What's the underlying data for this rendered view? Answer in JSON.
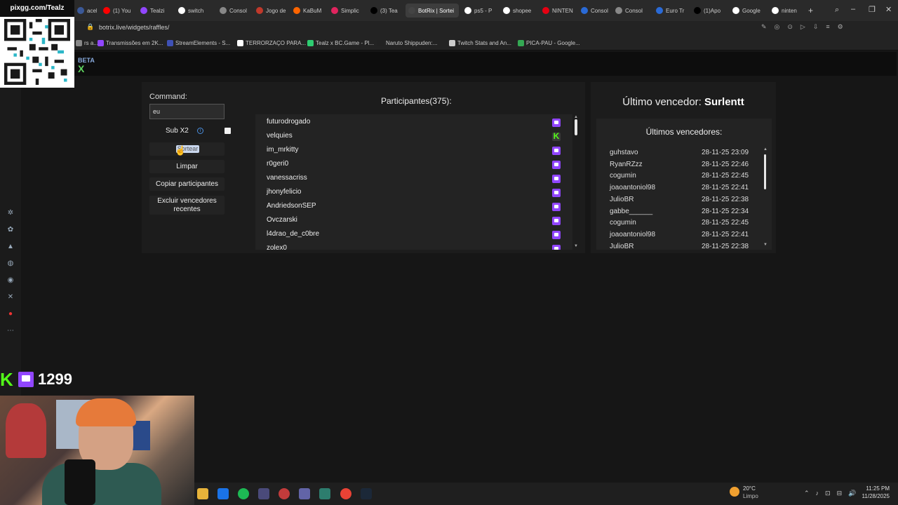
{
  "browser": {
    "tabs": [
      {
        "label": "acebo",
        "color": "#3b5998"
      },
      {
        "label": "(1) You",
        "color": "#ff0000"
      },
      {
        "label": "Tealzi",
        "color": "#9146ff"
      },
      {
        "label": "switch",
        "color": "#ffffff"
      },
      {
        "label": "Consol",
        "color": "#888888"
      },
      {
        "label": "Jogo de",
        "color": "#c0392b"
      },
      {
        "label": "KaBuM",
        "color": "#ff6500"
      },
      {
        "label": "Simplic",
        "color": "#e0245e"
      },
      {
        "label": "(3) Tea",
        "color": "#000000"
      },
      {
        "label": "BotRix | Sortei",
        "color": "#444444"
      },
      {
        "label": "ps5 - P",
        "color": "#ffffff"
      },
      {
        "label": "shopee",
        "color": "#ffffff"
      },
      {
        "label": "NINTEN",
        "color": "#e60012"
      },
      {
        "label": "Consol",
        "color": "#2a6ad6"
      },
      {
        "label": "Consol",
        "color": "#888888"
      },
      {
        "label": "Euro Tr",
        "color": "#2a6ad6"
      },
      {
        "label": "(1)Apo",
        "color": "#000000"
      },
      {
        "label": "Google",
        "color": "#ffffff"
      },
      {
        "label": "ninten",
        "color": "#ffffff"
      }
    ],
    "url": "botrix.live/widgets/raffles/",
    "bookmarks": [
      {
        "label": "rs a...",
        "color": "#888888"
      },
      {
        "label": "Transmissões em 2K...",
        "color": "#9146ff"
      },
      {
        "label": "StreamElements - S...",
        "color": "#3f51b5"
      },
      {
        "label": "TERRORZAÇO PARA...",
        "color": "#ffffff"
      },
      {
        "label": "Tealz x BC.Game - Pl...",
        "color": "#2ecc71"
      },
      {
        "label": "Naruto Shippuden:...",
        "color": "#222222"
      },
      {
        "label": "Twitch Stats and An...",
        "color": "#cccccc"
      },
      {
        "label": "PICA-PAU - Google...",
        "color": "#34a853"
      }
    ]
  },
  "overlay": {
    "qr_title": "pixgg.com/Tealz",
    "viewer_count": "1299"
  },
  "header": {
    "beta_label": "BETA",
    "logo": "X"
  },
  "raffle": {
    "command_label": "Command:",
    "command_value": "eu",
    "sub_label": "Sub X2",
    "buttons": {
      "draw": "Sortear",
      "clear": "Limpar",
      "copy": "Copiar participantes",
      "exclude": "Excluir vencedores recentes"
    },
    "participants_title": "Participantes(375):",
    "participants": [
      {
        "name": "futurodrogado",
        "platform": "twitch"
      },
      {
        "name": "velquies",
        "platform": "kick"
      },
      {
        "name": "im_mrkitty",
        "platform": "twitch"
      },
      {
        "name": "r0geri0",
        "platform": "twitch"
      },
      {
        "name": "vanessacriss",
        "platform": "twitch"
      },
      {
        "name": "jhonyfelicio",
        "platform": "twitch"
      },
      {
        "name": "AndriedsonSEP",
        "platform": "twitch"
      },
      {
        "name": "Ovczarski",
        "platform": "twitch"
      },
      {
        "name": "l4drao_de_c0bre",
        "platform": "twitch"
      },
      {
        "name": "zolex0",
        "platform": "twitch"
      }
    ]
  },
  "winners": {
    "last_winner_label": "Último vencedor:",
    "last_winner_name": "Surlentt",
    "recent_title": "Últimos vencedores:",
    "list": [
      {
        "name": "guhstavo",
        "date": "28-11-25 23:09"
      },
      {
        "name": "RyanRZzz",
        "date": "28-11-25 22:46"
      },
      {
        "name": "cogumin",
        "date": "28-11-25 22:45"
      },
      {
        "name": "joaoantoniol98",
        "date": "28-11-25 22:41"
      },
      {
        "name": "JulioBR",
        "date": "28-11-25 22:38"
      },
      {
        "name": "gabbe______",
        "date": "28-11-25 22:34"
      },
      {
        "name": "cogumin",
        "date": "28-11-25 22:45"
      },
      {
        "name": "joaoantoniol98",
        "date": "28-11-25 22:41"
      },
      {
        "name": "JulioBR",
        "date": "28-11-25 22:38"
      }
    ]
  },
  "taskbar": {
    "weather_temp": "20°C",
    "weather_status": "Limpo",
    "time": "11:25 PM",
    "date": "11/28/2025"
  },
  "colors": {
    "twitch": "#9146ff",
    "kick": "#53fc18",
    "panel": "#1c1c1c",
    "background": "#161616"
  }
}
